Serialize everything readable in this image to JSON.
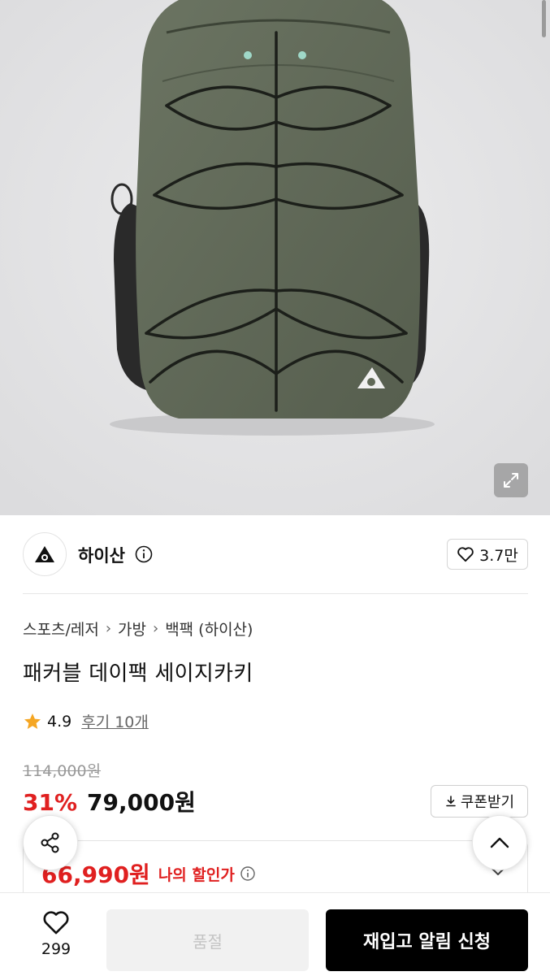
{
  "brand": {
    "name": "하이산",
    "likes": "3.7만"
  },
  "breadcrumb": [
    "스포츠/레저",
    "가방",
    "백팩 (하이산)"
  ],
  "product": {
    "title": "패커블 데이팩 세이지카키",
    "rating": "4.9",
    "reviews": "후기 10개",
    "original_price": "114,000원",
    "discount_rate": "31%",
    "sale_price": "79,000원",
    "my_price": "66,990원",
    "my_price_label": "나의 할인가"
  },
  "coupon": {
    "label": "쿠폰받기"
  },
  "bottom_bar": {
    "wish_count": "299",
    "soldout_label": "품절",
    "restock_label": "재입고 알림 신청"
  },
  "colors": {
    "accent_red": "#e02020",
    "primary_black": "#000000",
    "star": "#f5a623",
    "bag_khaki": "#616a58"
  },
  "icons": [
    "expand-icon",
    "brand-logo-icon",
    "info-icon",
    "heart-icon",
    "chevron-right-icon",
    "star-icon",
    "download-icon",
    "share-icon",
    "chevron-up-icon",
    "chevron-down-icon"
  ]
}
